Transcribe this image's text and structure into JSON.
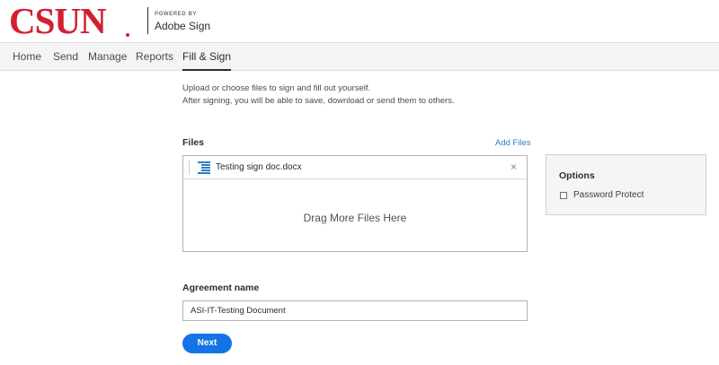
{
  "header": {
    "logo_text": "CSUN",
    "powered_by": "POWERED BY",
    "product": "Adobe Sign"
  },
  "nav": {
    "items": [
      {
        "label": "Home"
      },
      {
        "label": "Send"
      },
      {
        "label": "Manage"
      },
      {
        "label": "Reports"
      },
      {
        "label": "Fill & Sign"
      }
    ],
    "active": "Fill & Sign"
  },
  "intro": {
    "line1": "Upload or choose files to sign and fill out yourself.",
    "line2": "After signing, you will be able to save, download or send them to others."
  },
  "files": {
    "label": "Files",
    "add_label": "Add Files",
    "items": [
      {
        "name": "Testing sign doc.docx",
        "icon": "document-icon"
      }
    ],
    "remove_glyph": "×",
    "drop_text": "Drag More Files Here"
  },
  "options": {
    "title": "Options",
    "password_protect_label": "Password Protect",
    "password_protect_checked": false
  },
  "agreement": {
    "label": "Agreement name",
    "value": "ASI-IT-Testing Document"
  },
  "actions": {
    "next_label": "Next"
  },
  "colors": {
    "brand_red": "#d22030",
    "link_blue": "#2d7ec4",
    "primary_button": "#1473e6"
  }
}
